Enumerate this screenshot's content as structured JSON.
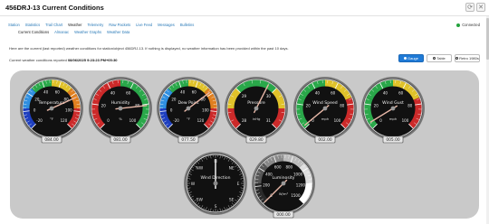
{
  "title": "456DRJ-13 Current Conditions",
  "top_icons": [
    {
      "name": "refresh-icon",
      "glyph": "⟳"
    },
    {
      "name": "close-icon",
      "glyph": "✕"
    }
  ],
  "tabs": [
    "Station",
    "Statistics",
    "Trail Chart",
    "Weather",
    "Telemetry",
    "Raw Packets",
    "Live Feed",
    "Messages",
    "Bulletins"
  ],
  "active_tab": 3,
  "status": {
    "label": "Connected",
    "color": "#22a33c"
  },
  "subtabs": [
    "Current Conditions",
    "Almanac",
    "Weather Graphs",
    "Weather Data"
  ],
  "active_subtab": 0,
  "description": "Here are the current (last reported) weather conditions for station/object 456DRJ-13. If nothing is displayed, no weather information has been provided within the past 10 days.",
  "reported_prefix": "Current weather conditions reported",
  "reported_time": "08/06/2025 9:23:23 PM+05:30",
  "view_buttons": [
    {
      "label": "Gauge",
      "active": true
    },
    {
      "label": "Table",
      "active": false
    },
    {
      "label": "Retro 1980s",
      "active": false
    }
  ],
  "gauges": [
    {
      "key": "temperature",
      "label": "Temperature",
      "unit": "°F",
      "readout": "084.00",
      "value": 84,
      "min": -20,
      "max": 120,
      "ticks": [
        "-20",
        "0",
        "20",
        "40",
        "60",
        "80",
        "100",
        "120"
      ],
      "bands": [
        "#1e3fbf",
        "#2f8fe0",
        "#2aa84a",
        "#e0c22a",
        "#e07f1f",
        "#cc2a2a"
      ]
    },
    {
      "key": "humidity",
      "label": "Humidity",
      "unit": "%",
      "readout": "081.00",
      "value": 81,
      "min": 0,
      "max": 100,
      "ticks": [
        "0",
        "20",
        "40",
        "60",
        "80",
        "100"
      ],
      "bands": [
        "#cc2a2a",
        "#cc2a2a",
        "#2aa84a",
        "#2aa84a"
      ]
    },
    {
      "key": "dew_point",
      "label": "Dew Point",
      "unit": "°F",
      "readout": "077.50",
      "value": 77.5,
      "min": -20,
      "max": 120,
      "ticks": [
        "-20",
        "0",
        "20",
        "40",
        "60",
        "80",
        "100",
        "120"
      ],
      "bands": [
        "#1e3fbf",
        "#2f8fe0",
        "#2aa84a",
        "#e0c22a",
        "#e07f1f",
        "#cc2a2a"
      ]
    },
    {
      "key": "pressure",
      "label": "Pressure",
      "unit": "inHg",
      "readout": "029.80",
      "value": 29.8,
      "min": 28,
      "max": 31,
      "ticks": [
        "28",
        "29",
        "30",
        "31"
      ],
      "bands": [
        "#cc2a2a",
        "#e0c22a",
        "#2aa84a",
        "#2aa84a",
        "#e0c22a",
        "#cc2a2a"
      ]
    },
    {
      "key": "wind_speed",
      "label": "Wind Speed",
      "unit": "mph",
      "readout": "002.00",
      "value": 2,
      "min": 0,
      "max": 100,
      "ticks": [
        "0",
        "20",
        "40",
        "60",
        "80",
        "100"
      ],
      "bands": [
        "#2aa84a",
        "#2aa84a",
        "#e0c22a",
        "#cc2a2a"
      ]
    },
    {
      "key": "wind_gust",
      "label": "Wind Gust",
      "unit": "mph",
      "readout": "005.00",
      "value": 5,
      "min": 0,
      "max": 100,
      "ticks": [
        "0",
        "20",
        "40",
        "60",
        "80",
        "100"
      ],
      "bands": [
        "#2aa84a",
        "#2aa84a",
        "#e0c22a",
        "#cc2a2a"
      ]
    },
    {
      "key": "wind_direction",
      "label": "Wind Direction",
      "unit": "",
      "readout": "",
      "value": 0,
      "min": 0,
      "max": 360,
      "ticks": [
        "N",
        "NE",
        "E",
        "SE",
        "S",
        "SW",
        "W",
        "NW"
      ],
      "bands": [],
      "compass": true
    },
    {
      "key": "luminosity",
      "label": "Luminosity",
      "unit": "W/m²",
      "readout": "000.00",
      "value": 0,
      "min": 0,
      "max": 1500,
      "ticks": [
        "0",
        "200",
        "400",
        "600",
        "800",
        "1000",
        "1200",
        "1500"
      ],
      "bands": [
        "#2a2a2a",
        "#555",
        "#888",
        "#bbb",
        "#ddd",
        "#fff"
      ]
    }
  ]
}
